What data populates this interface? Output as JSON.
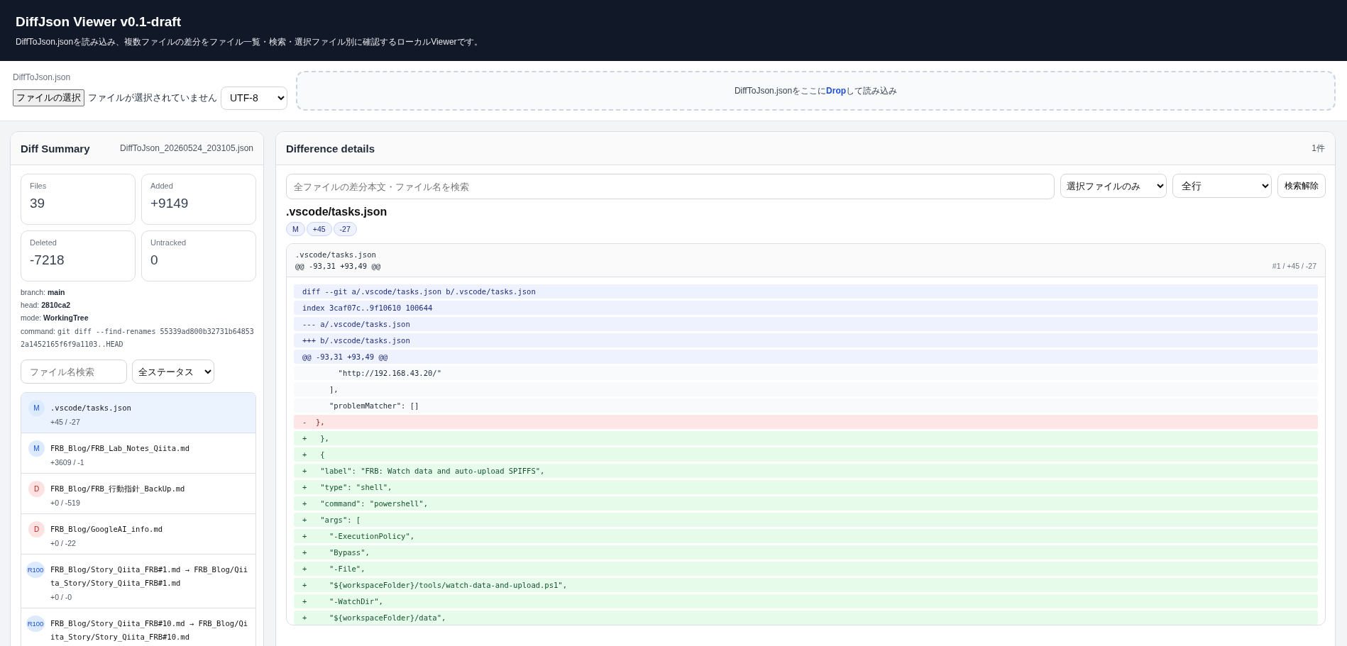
{
  "header": {
    "title": "DiffJson Viewer v0.1-draft",
    "subtitle": "DiffToJson.jsonを読み込み、複数ファイルの差分をファイル一覧・検索・選択ファイル別に確認するローカルViewerです。"
  },
  "loader": {
    "label": "DiffToJson.json",
    "file_button": "ファイルの選択",
    "file_status": "ファイルが選択されていません",
    "encoding": "UTF-8",
    "drop_text": "DiffToJson.jsonをここに**Drop**して読み込み"
  },
  "summary": {
    "title": "Diff Summary",
    "file_name": "DiffToJson_20260524_203105.json",
    "stats": [
      {
        "label": "Files",
        "value": "39"
      },
      {
        "label": "Added",
        "value": "+9149"
      },
      {
        "label": "Deleted",
        "value": "-7218"
      },
      {
        "label": "Untracked",
        "value": "0"
      }
    ],
    "meta": [
      {
        "kind": "text",
        "label": "branch:",
        "value": "main"
      },
      {
        "kind": "text",
        "label": "head:",
        "value": "2810ca2"
      },
      {
        "kind": "text",
        "label": "mode:",
        "value": "WorkingTree"
      },
      {
        "kind": "code",
        "label": "command:",
        "value": "git diff --find-renames 55339ad800b32731b648532a1452165f6f9a1103..HEAD"
      }
    ],
    "file_search": {
      "placeholder": "ファイル名検索"
    },
    "status_filter": "全ステータス",
    "files": [
      {
        "status": "M",
        "kind": "modified",
        "path": ".vscode/tasks.json",
        "stats": "+45 / -27",
        "selected": true
      },
      {
        "status": "M",
        "kind": "modified",
        "path": "FRB_Blog/FRB_Lab_Notes_Qiita.md",
        "stats": "+3609 / -1",
        "selected": false
      },
      {
        "status": "D",
        "kind": "deleted",
        "path": "FRB_Blog/FRB_行動指針_BackUp.md",
        "stats": "+0 / -519",
        "selected": false
      },
      {
        "status": "D",
        "kind": "deleted",
        "path": "FRB_Blog/GoogleAI_info.md",
        "stats": "+0 / -22",
        "selected": false
      },
      {
        "status": "R100",
        "kind": "renamed",
        "path": "FRB_Blog/Story_Qiita_FRB#1.md → FRB_Blog/Qiita_Story/Story_Qiita_FRB#1.md",
        "stats": "+0 / -0",
        "selected": false
      },
      {
        "status": "R100",
        "kind": "renamed",
        "path": "FRB_Blog/Story_Qiita_FRB#10.md → FRB_Blog/Qiita_Story/Story_Qiita_FRB#10.md",
        "selected": false
      }
    ]
  },
  "details": {
    "title": "Difference details",
    "count": "1件",
    "search": {
      "placeholder": "全ファイルの差分本文・ファイル名を検索"
    },
    "scope": "選択ファイルのみ",
    "lines": "全行",
    "clear_button": "検索解除",
    "file_title": ".vscode/tasks.json",
    "pills": [
      "M",
      "+45",
      "-27"
    ],
    "hunk": {
      "file": ".vscode/tasks.json",
      "range": "@@ -93,31 +93,49 @@",
      "info": "#1 / +45 / -27",
      "lines": [
        {
          "kind": "meta",
          "text": "diff --git a/.vscode/tasks.json b/.vscode/tasks.json"
        },
        {
          "kind": "meta",
          "text": "index 3caf07c..9f10610 100644"
        },
        {
          "kind": "meta",
          "text": "--- a/.vscode/tasks.json"
        },
        {
          "kind": "meta",
          "text": "+++ b/.vscode/tasks.json"
        },
        {
          "kind": "meta",
          "text": "@@ -93,31 +93,49 @@"
        },
        {
          "kind": "context",
          "text": "        \"http://192.168.43.20/\""
        },
        {
          "kind": "context",
          "text": "      ],"
        },
        {
          "kind": "context",
          "text": "      \"problemMatcher\": []"
        },
        {
          "kind": "del",
          "sign": "-",
          "text": "  },"
        },
        {
          "kind": "add",
          "sign": "+",
          "text": "   },"
        },
        {
          "kind": "add",
          "sign": "+",
          "text": "   {"
        },
        {
          "kind": "add",
          "sign": "+",
          "text": "   \"label\": \"FRB: Watch data and auto-upload SPIFFS\","
        },
        {
          "kind": "add",
          "sign": "+",
          "text": "   \"type\": \"shell\","
        },
        {
          "kind": "add",
          "sign": "+",
          "text": "   \"command\": \"powershell\","
        },
        {
          "kind": "add",
          "sign": "+",
          "text": "   \"args\": ["
        },
        {
          "kind": "add",
          "sign": "+",
          "text": "     \"-ExecutionPolicy\","
        },
        {
          "kind": "add",
          "sign": "+",
          "text": "     \"Bypass\","
        },
        {
          "kind": "add",
          "sign": "+",
          "text": "     \"-File\","
        },
        {
          "kind": "add",
          "sign": "+",
          "text": "     \"${workspaceFolder}/tools/watch-data-and-upload.ps1\","
        },
        {
          "kind": "add",
          "sign": "+",
          "text": "     \"-WatchDir\","
        },
        {
          "kind": "add",
          "sign": "+",
          "text": "     \"${workspaceFolder}/data\","
        }
      ]
    }
  }
}
